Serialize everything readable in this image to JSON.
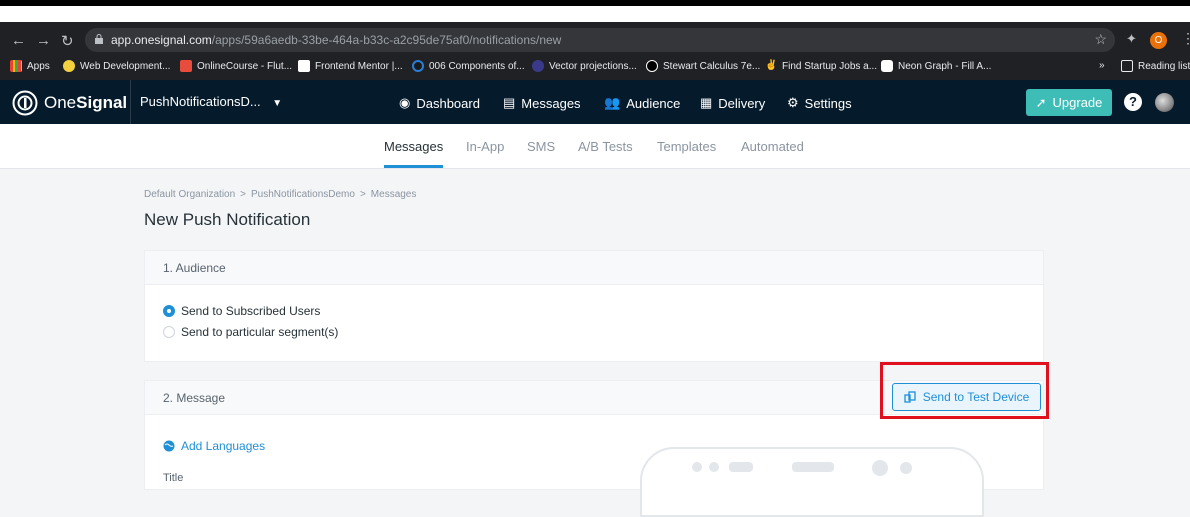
{
  "browser": {
    "url_host": "app.onesignal.com",
    "url_path": "/apps/59a6aedb-33be-464a-b33c-a2c95de75af0/notifications/new",
    "profile_initial": "O",
    "bookmarks": [
      "Apps",
      "Web Development...",
      "OnlineCourse - Flut...",
      "Frontend Mentor |...",
      "006 Components of...",
      "Vector projections...",
      "Stewart Calculus 7e...",
      "Find Startup Jobs a...",
      "Neon Graph - Fill A..."
    ],
    "reading_list": "Reading list",
    "more": "»"
  },
  "app": {
    "logo_text_one": "One",
    "logo_text_two": "Signal",
    "app_name": "PushNotificationsD...",
    "nav": [
      "Dashboard",
      "Messages",
      "Audience",
      "Delivery",
      "Settings"
    ],
    "upgrade": "Upgrade",
    "help": "?"
  },
  "subnav": [
    "Messages",
    "In-App",
    "SMS",
    "A/B Tests",
    "Templates",
    "Automated"
  ],
  "breadcrumb": [
    "Default Organization",
    "PushNotificationsDemo",
    "Messages"
  ],
  "breadcrumb_sep": ">",
  "page_title": "New Push Notification",
  "audience": {
    "header": "1. Audience",
    "options": [
      "Send to Subscribed Users",
      "Send to particular segment(s)"
    ]
  },
  "message": {
    "header": "2. Message",
    "test_button": "Send to Test Device",
    "add_languages": "Add Languages",
    "title_label": "Title"
  },
  "colors": {
    "accent": "#1f8fd6",
    "upgrade": "#3ebdb6",
    "nav_bg": "#051b2c",
    "highlight": "#e0101e"
  }
}
